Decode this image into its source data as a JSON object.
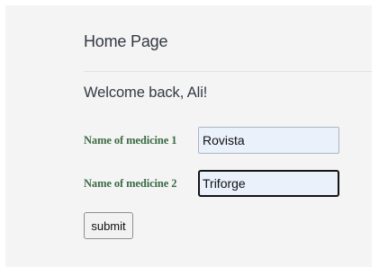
{
  "page": {
    "title": "Home Page",
    "welcome": "Welcome back, Ali!"
  },
  "form": {
    "medicine1": {
      "label": "Name of medicine 1",
      "value": "Rovista"
    },
    "medicine2": {
      "label": "Name of medicine 2",
      "value": "Triforge"
    },
    "submit_label": "submit"
  }
}
